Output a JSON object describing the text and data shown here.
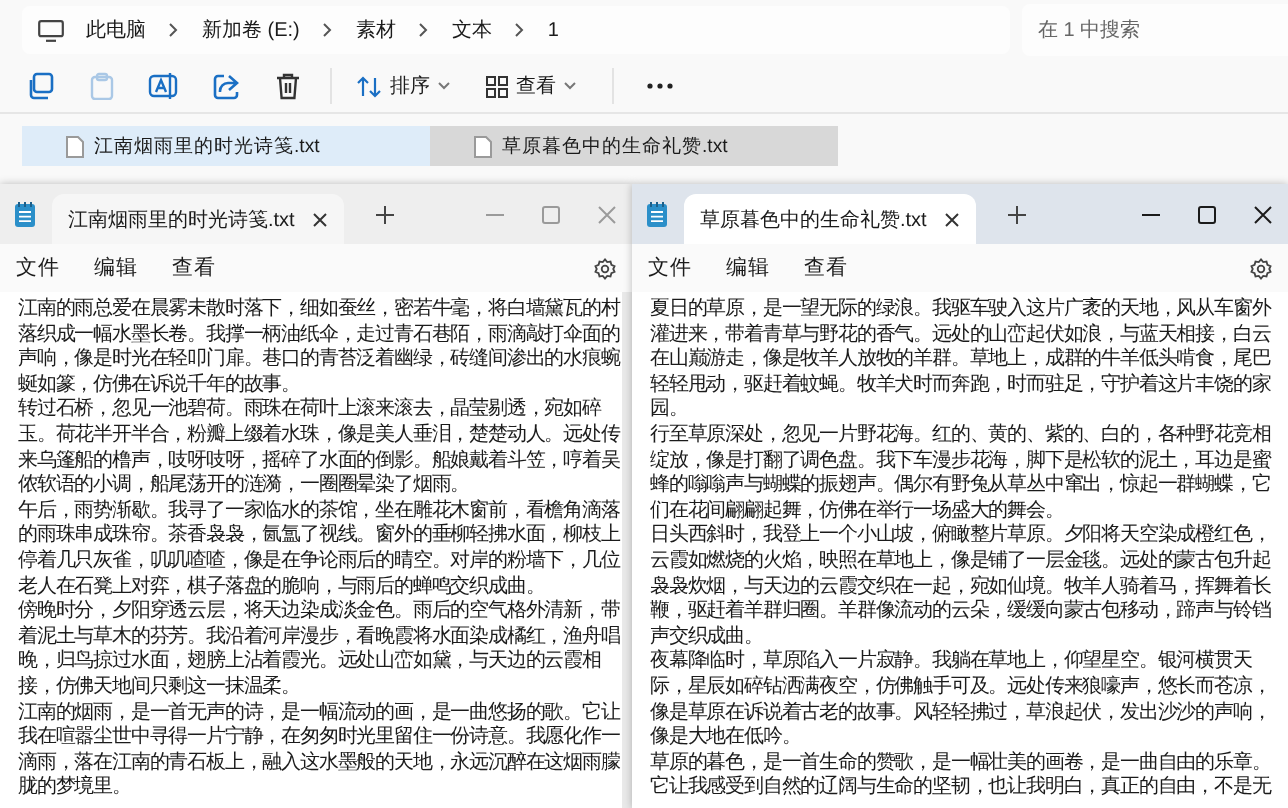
{
  "explorer": {
    "breadcrumbs": [
      "此电脑",
      "新加卷 (E:)",
      "素材",
      "文本",
      "1"
    ],
    "search": {
      "placeholder": "在 1 中搜索"
    },
    "toolbar_icons": [
      {
        "kind": "copy",
        "disabled": false
      },
      {
        "kind": "paste",
        "disabled": true
      },
      {
        "kind": "rename",
        "disabled": false
      },
      {
        "kind": "share",
        "disabled": false
      },
      {
        "kind": "delete",
        "disabled": false
      }
    ],
    "sort": "排序",
    "view": "查看",
    "files": [
      {
        "name": "江南烟雨里的时光诗笺.txt",
        "selected": true,
        "hovered": false
      },
      {
        "name": "草原暮色中的生命礼赞.txt",
        "selected": false,
        "hovered": true
      }
    ]
  },
  "windows": [
    {
      "tab_title": "江南烟雨里的时光诗笺.txt",
      "active": false,
      "menu": [
        "文件",
        "编辑",
        "查看"
      ],
      "paragraphs": [
        "江南的雨总爱在晨雾未散时落下，细如蚕丝，密若牛毫，将白墙黛瓦的村落织成一幅水墨长卷。我撑一柄油纸伞，走过青石巷陌，雨滴敲打伞面的声响，像是时光在轻叩门扉。巷口的青苔泛着幽绿，砖缝间渗出的水痕蜿蜒如篆，仿佛在诉说千年的故事。",
        "转过石桥，忽见一池碧荷。雨珠在荷叶上滚来滚去，晶莹剔透，宛如碎玉。荷花半开半合，粉瓣上缀着水珠，像是美人垂泪，楚楚动人。远处传来乌篷船的橹声，吱呀吱呀，摇碎了水面的倒影。船娘戴着斗笠，哼着吴侬软语的小调，船尾荡开的涟漪，一圈圈晕染了烟雨。",
        "午后，雨势渐歇。我寻了一家临水的茶馆，坐在雕花木窗前，看檐角滴落的雨珠串成珠帘。茶香袅袅，氤氲了视线。窗外的垂柳轻拂水面，柳枝上停着几只灰雀，叽叽喳喳，像是在争论雨后的晴空。对岸的粉墙下，几位老人在石凳上对弈，棋子落盘的脆响，与雨后的蝉鸣交织成曲。",
        "傍晚时分，夕阳穿透云层，将天边染成淡金色。雨后的空气格外清新，带着泥土与草木的芬芳。我沿着河岸漫步，看晚霞将水面染成橘红，渔舟唱晚，归鸟掠过水面，翅膀上沾着霞光。远处山峦如黛，与天边的云霞相接，仿佛天地间只剩这一抹温柔。",
        "江南的烟雨，是一首无声的诗，是一幅流动的画，是一曲悠扬的歌。它让我在喧嚣尘世中寻得一片宁静，在匆匆时光里留住一份诗意。我愿化作一滴雨，落在江南的青石板上，融入这水墨般的天地，永远沉醉在这烟雨朦胧的梦境里。"
      ]
    },
    {
      "tab_title": "草原暮色中的生命礼赞.txt",
      "active": true,
      "menu": [
        "文件",
        "编辑",
        "查看"
      ],
      "paragraphs": [
        "夏日的草原，是一望无际的绿浪。我驱车驶入这片广袤的天地，风从车窗外灌进来，带着青草与野花的香气。远处的山峦起伏如浪，与蓝天相接，白云在山巅游走，像是牧羊人放牧的羊群。草地上，成群的牛羊低头啃食，尾巴轻轻甩动，驱赶着蚊蝇。牧羊犬时而奔跑，时而驻足，守护着这片丰饶的家园。",
        "行至草原深处，忽见一片野花海。红的、黄的、紫的、白的，各种野花竞相绽放，像是打翻了调色盘。我下车漫步花海，脚下是松软的泥土，耳边是蜜蜂的嗡嗡声与蝴蝶的振翅声。偶尔有野兔从草丛中窜出，惊起一群蝴蝶，它们在花间翩翩起舞，仿佛在举行一场盛大的舞会。",
        "日头西斜时，我登上一个小山坡，俯瞰整片草原。夕阳将天空染成橙红色，云霞如燃烧的火焰，映照在草地上，像是铺了一层金毯。远处的蒙古包升起袅袅炊烟，与天边的云霞交织在一起，宛如仙境。牧羊人骑着马，挥舞着长鞭，驱赶着羊群归圈。羊群像流动的云朵，缓缓向蒙古包移动，蹄声与铃铛声交织成曲。",
        "夜幕降临时，草原陷入一片寂静。我躺在草地上，仰望星空。银河横贯天际，星辰如碎钻洒满夜空，仿佛触手可及。远处传来狼嚎声，悠长而苍凉，像是草原在诉说着古老的故事。风轻轻拂过，草浪起伏，发出沙沙的声响，像是大地在低吟。",
        "草原的暮色，是一首生命的赞歌，是一幅壮美的画卷，是一曲自由的乐章。它让我感受到自然的辽阔与生命的坚韧，也让我明白，真正的自由，不是无"
      ]
    }
  ]
}
